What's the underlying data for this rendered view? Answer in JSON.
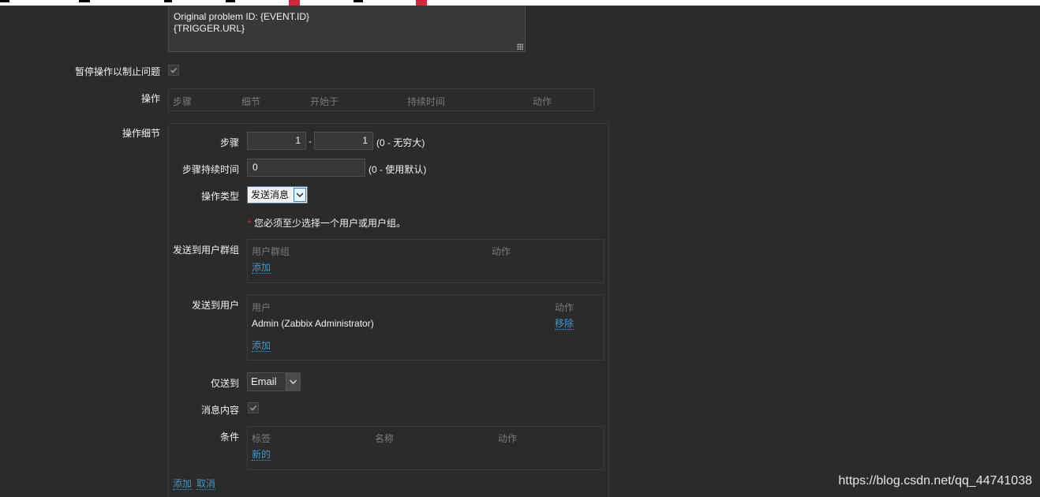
{
  "message_body": {
    "lines": [
      "Original problem ID: {EVENT.ID}",
      "{TRIGGER.URL}"
    ]
  },
  "pause_operations": {
    "label": "暂停操作以制止问题",
    "checked": true
  },
  "operations": {
    "label": "操作",
    "headers": [
      "步骤",
      "细节",
      "开始于",
      "持续时间",
      "动作"
    ]
  },
  "operation_details": {
    "label": "操作细节",
    "steps": {
      "label": "步骤",
      "from": "1",
      "separator": "-",
      "to": "1",
      "hint": "(0 - 无穷大)"
    },
    "step_duration": {
      "label": "步骤持续时间",
      "value": "0",
      "hint": "(0 - 使用默认)"
    },
    "operation_type": {
      "label": "操作类型",
      "value": "发送消息"
    },
    "required_note": {
      "asterisk": "*",
      "text": "您必须至少选择一个用户或用户组。"
    },
    "user_groups": {
      "label": "发送到用户群组",
      "headers": [
        "用户群组",
        "动作"
      ],
      "add_link": "添加"
    },
    "users": {
      "label": "发送到用户",
      "headers": [
        "用户",
        "动作"
      ],
      "rows": [
        {
          "user": "Admin (Zabbix Administrator)",
          "action": "移除"
        }
      ],
      "add_link": "添加"
    },
    "send_only_to": {
      "label": "仅送到",
      "value": "Email"
    },
    "default_message": {
      "label": "消息内容",
      "checked": true
    },
    "conditions": {
      "label": "条件",
      "headers": [
        "标签",
        "名称",
        "动作"
      ],
      "new_link": "新的"
    },
    "footer": {
      "add_link": "添加",
      "cancel_link": "取消"
    }
  },
  "watermark": "https://blog.csdn.net/qq_44741038",
  "colors": {
    "background": "#2b2b2b",
    "link": "#4796c4",
    "header_text": "#7a7a7a",
    "accent_red": "#d3273b"
  }
}
